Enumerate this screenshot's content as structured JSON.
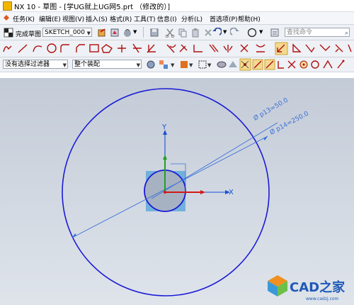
{
  "window": {
    "title": "NX 10 - 草图 - [学UG就上UG网5.prt （修改的）]"
  },
  "menu": [
    {
      "label": "任务(K)",
      "key": "task"
    },
    {
      "label": "编辑(E)",
      "key": "edit"
    },
    {
      "label": "视图(V)",
      "key": "view"
    },
    {
      "label": "插入(S)",
      "key": "insert"
    },
    {
      "label": "格式(R)",
      "key": "format"
    },
    {
      "label": "工具(T)",
      "key": "tools"
    },
    {
      "label": "信息(I)",
      "key": "info"
    },
    {
      "label": "分析(L)",
      "key": "analysis"
    },
    {
      "label": "首选项(P)",
      "key": "prefs"
    },
    {
      "label": "帮助(H)",
      "key": "help"
    }
  ],
  "toolbar1": {
    "finish_sketch": "完成草图",
    "sketch_name": "SKETCH_000",
    "search_placeholder": "查找命令"
  },
  "toolbar3": {
    "filter": "没有选择过滤器",
    "assembly": "整个装配"
  },
  "sketch": {
    "dims": [
      {
        "label": "Ø p13=50.0"
      },
      {
        "label": "Ø p14=250.0"
      }
    ],
    "axes": {
      "x": "X",
      "y": "Y"
    }
  },
  "watermark": {
    "name": "CAD之家",
    "url": "www.cadzj.com"
  },
  "colors": {
    "sketch_curve": "#1a1ad6",
    "dimension": "#3a6fd8",
    "x_axis": "#d41818",
    "y_axis": "#1a4fd6",
    "z_axis": "#20a020",
    "canvas_top": "#c3cbd7",
    "canvas_bottom": "#dfe4eb"
  }
}
